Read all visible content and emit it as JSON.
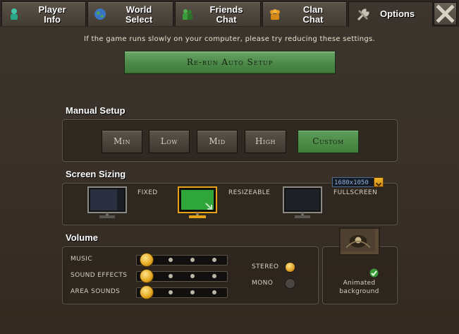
{
  "tabs": [
    {
      "line1": "Player",
      "line2": "Info",
      "icon": "player-info-icon"
    },
    {
      "line1": "World",
      "line2": "Select",
      "icon": "globe-icon"
    },
    {
      "line1": "Friends",
      "line2": "Chat",
      "icon": "friends-icon"
    },
    {
      "line1": "Clan",
      "line2": "Chat",
      "icon": "clan-icon"
    },
    {
      "line1": "Options",
      "line2": "",
      "icon": "wrench-icon",
      "active": true
    }
  ],
  "close_icon": "close-icon",
  "hint": "If the game runs slowly on your computer, please try reducing these settings.",
  "auto_setup": "Re-run Auto Setup",
  "manual": {
    "title": "Manual Setup",
    "presets": [
      "Min",
      "Low",
      "Mid",
      "High",
      "Custom"
    ],
    "selected": "Custom"
  },
  "screen": {
    "title": "Screen Sizing",
    "modes": [
      "Fixed",
      "Resizeable",
      "Fullscreen"
    ],
    "selected": "Resizeable",
    "resolution": "1680x1050"
  },
  "volume": {
    "title": "Volume",
    "channels": [
      {
        "label": "Music",
        "level": 0.0
      },
      {
        "label": "Sound Effects",
        "level": 0.0
      },
      {
        "label": "Area Sounds",
        "level": 0.0
      }
    ],
    "stereo_label": "Stereo",
    "mono_label": "Mono",
    "mode": "Stereo"
  },
  "background": {
    "line1": "Animated",
    "line2": "background",
    "enabled": true
  },
  "colors": {
    "accent_green": "#4c8948",
    "accent_gold": "#e3a41c",
    "panel_bg": "#3a322a"
  }
}
